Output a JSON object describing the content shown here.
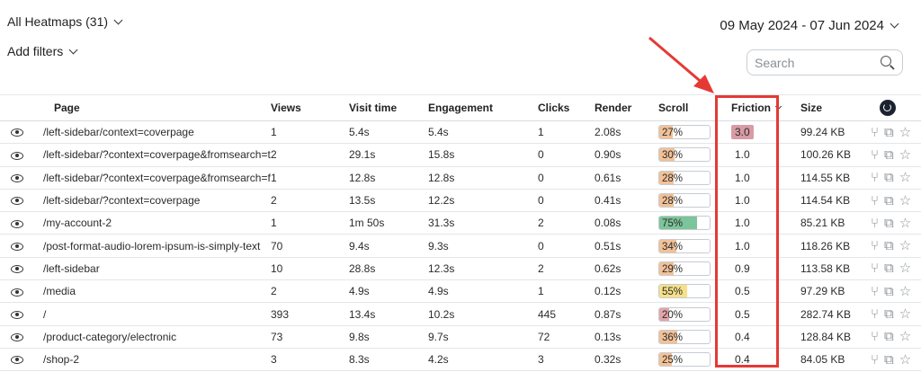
{
  "header": {
    "heatmaps_label": "All Heatmaps (31)",
    "filters_label": "Add filters",
    "date_range": "09 May 2024 - 07 Jun 2024",
    "search_placeholder": "Search"
  },
  "table": {
    "columns": [
      "Page",
      "Views",
      "Visit time",
      "Engagement",
      "Clicks",
      "Render",
      "Scroll",
      "Friction",
      "Size"
    ],
    "rows": [
      {
        "page": "/left-sidebar/context=coverpage",
        "views": "1",
        "visit": "5.4s",
        "engagement": "5.4s",
        "clicks": "1",
        "render": "2.08s",
        "scroll": 27,
        "scroll_label": "27%",
        "friction": "3.0",
        "size": "99.24 KB"
      },
      {
        "page": "/left-sidebar/?context=coverpage&fromsearch=true",
        "views": "2",
        "visit": "29.1s",
        "engagement": "15.8s",
        "clicks": "0",
        "render": "0.90s",
        "scroll": 30,
        "scroll_label": "30%",
        "friction": "1.0",
        "size": "100.26 KB"
      },
      {
        "page": "/left-sidebar/?context=coverpage&fromsearch=false",
        "views": "1",
        "visit": "12.8s",
        "engagement": "12.8s",
        "clicks": "0",
        "render": "0.61s",
        "scroll": 28,
        "scroll_label": "28%",
        "friction": "1.0",
        "size": "114.55 KB"
      },
      {
        "page": "/left-sidebar/?context=coverpage",
        "views": "2",
        "visit": "13.5s",
        "engagement": "12.2s",
        "clicks": "0",
        "render": "0.41s",
        "scroll": 28,
        "scroll_label": "28%",
        "friction": "1.0",
        "size": "114.54 KB"
      },
      {
        "page": "/my-account-2",
        "views": "1",
        "visit": "1m 50s",
        "engagement": "31.3s",
        "clicks": "2",
        "render": "0.08s",
        "scroll": 75,
        "scroll_label": "75%",
        "friction": "1.0",
        "size": "85.21 KB"
      },
      {
        "page": "/post-format-audio-lorem-ipsum-is-simply-text",
        "views": "70",
        "visit": "9.4s",
        "engagement": "9.3s",
        "clicks": "0",
        "render": "0.51s",
        "scroll": 34,
        "scroll_label": "34%",
        "friction": "1.0",
        "size": "118.26 KB"
      },
      {
        "page": "/left-sidebar",
        "views": "10",
        "visit": "28.8s",
        "engagement": "12.3s",
        "clicks": "2",
        "render": "0.62s",
        "scroll": 29,
        "scroll_label": "29%",
        "friction": "0.9",
        "size": "113.58 KB"
      },
      {
        "page": "/media",
        "views": "2",
        "visit": "4.9s",
        "engagement": "4.9s",
        "clicks": "1",
        "render": "0.12s",
        "scroll": 55,
        "scroll_label": "55%",
        "friction": "0.5",
        "size": "97.29 KB"
      },
      {
        "page": "/",
        "views": "393",
        "visit": "13.4s",
        "engagement": "10.2s",
        "clicks": "445",
        "render": "0.87s",
        "scroll": 20,
        "scroll_label": "20%",
        "friction": "0.5",
        "size": "282.74 KB"
      },
      {
        "page": "/product-category/electronic",
        "views": "73",
        "visit": "9.8s",
        "engagement": "9.7s",
        "clicks": "72",
        "render": "0.13s",
        "scroll": 36,
        "scroll_label": "36%",
        "friction": "0.4",
        "size": "128.84 KB"
      },
      {
        "page": "/shop-2",
        "views": "3",
        "visit": "8.3s",
        "engagement": "4.2s",
        "clicks": "3",
        "render": "0.32s",
        "scroll": 25,
        "scroll_label": "25%",
        "friction": "0.4",
        "size": "84.05 KB"
      }
    ]
  },
  "colors": {
    "scroll_low": "#f2c197",
    "scroll_mid": "#f6e08a",
    "scroll_high": "#7cc49a",
    "scroll_min": "#e4a3a8",
    "friction_high": "#d99ba5",
    "annotation": "#e53935"
  },
  "icons": {
    "row_view": "eye-icon",
    "row_share": "share-icon",
    "row_open": "open-icon",
    "row_star": "star-icon",
    "refresh": "refresh-icon",
    "search": "search-icon"
  }
}
